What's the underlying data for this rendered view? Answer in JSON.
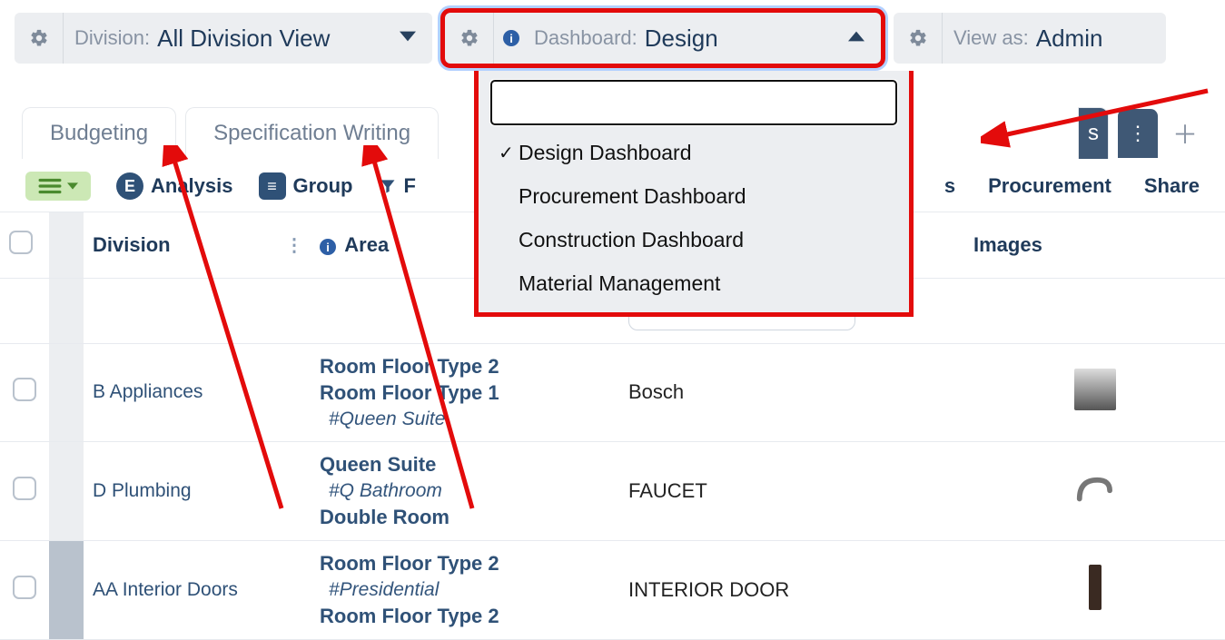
{
  "selectors": {
    "division": {
      "label": "Division:",
      "value": "All Division View"
    },
    "dashboard": {
      "label": "Dashboard:",
      "value": "Design"
    },
    "viewas": {
      "label": "View as:",
      "value": "Admin"
    }
  },
  "dashboard_dropdown": {
    "search_placeholder": "",
    "items": [
      {
        "label": "Design Dashboard",
        "selected": true
      },
      {
        "label": "Procurement Dashboard",
        "selected": false
      },
      {
        "label": "Construction Dashboard",
        "selected": false
      },
      {
        "label": "Material Management",
        "selected": false
      }
    ]
  },
  "tabs": {
    "items": [
      "Budgeting",
      "Specification Writing"
    ],
    "truncated_tab_suffix": "s"
  },
  "toolbar": {
    "analysis": "Analysis",
    "group": "Group",
    "filter": "F",
    "right": [
      "s",
      "Procurement",
      "Share"
    ]
  },
  "table": {
    "headers": {
      "division": "Division",
      "area": "Area",
      "images": "Images"
    },
    "manuf_search_placeholder": "",
    "rows": [
      {
        "division": "B Appliances",
        "area_lines": [
          "Room Floor Type 2",
          "Room Floor Type 1"
        ],
        "area_sub": "#Queen Suite",
        "manufacturer": "Bosch",
        "image_hint": "oven"
      },
      {
        "division": "D Plumbing",
        "area_lines": [
          "Queen Suite"
        ],
        "area_sub": "#Q Bathroom",
        "area_after": "Double Room",
        "manufacturer": "FAUCET",
        "image_hint": "faucet"
      },
      {
        "division": "AA Interior Doors",
        "area_lines": [
          "Room Floor Type 2"
        ],
        "area_sub": "#Presidential",
        "area_after": "Room Floor Type 2",
        "manufacturer": "INTERIOR DOOR",
        "image_hint": "door"
      }
    ]
  }
}
